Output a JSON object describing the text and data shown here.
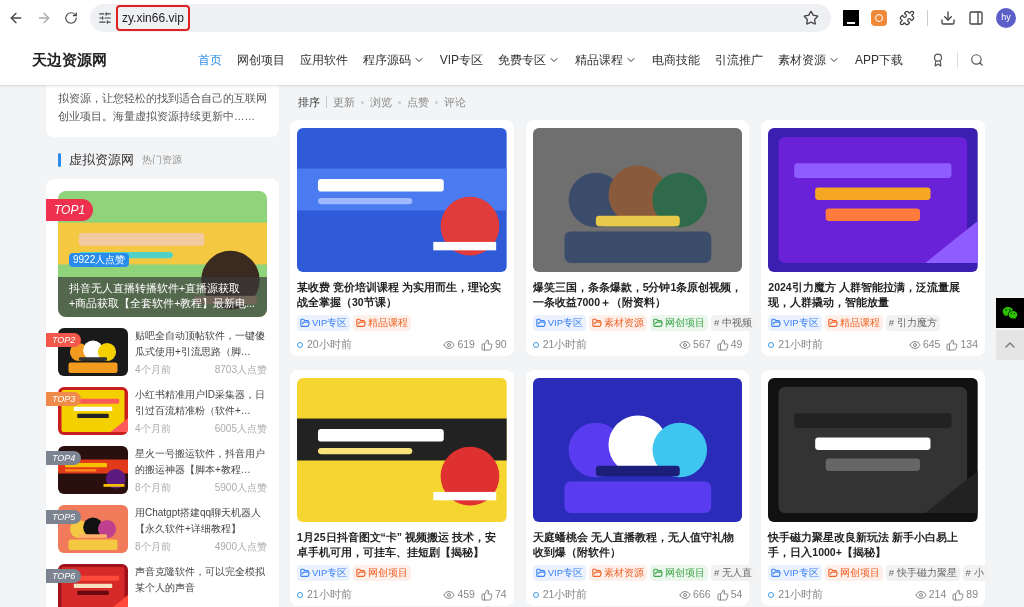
{
  "browser": {
    "url": "zy.xin66.vip",
    "profile": "hy"
  },
  "header": {
    "logo": "天边资源网",
    "nav": [
      {
        "label": "首页",
        "selected": true,
        "dropdown": false
      },
      {
        "label": "网创项目",
        "selected": false,
        "dropdown": false
      },
      {
        "label": "应用软件",
        "selected": false,
        "dropdown": false
      },
      {
        "label": "程序源码",
        "selected": false,
        "dropdown": true
      },
      {
        "label": "VIP专区",
        "selected": false,
        "dropdown": false
      },
      {
        "label": "免费专区",
        "selected": false,
        "dropdown": true
      },
      {
        "label": "精品课程",
        "selected": false,
        "dropdown": true
      },
      {
        "label": "电商技能",
        "selected": false,
        "dropdown": false
      },
      {
        "label": "引流推广",
        "selected": false,
        "dropdown": false
      },
      {
        "label": "素材资源",
        "selected": false,
        "dropdown": true
      },
      {
        "label": "APP下载",
        "selected": false,
        "dropdown": false
      }
    ]
  },
  "sidebar": {
    "intro": "拟资源，让您轻松的找到适合自己的互联网创业项目。海量虚拟资源持续更新中……",
    "section_title": "虚拟资源网",
    "section_subtitle": "热门资源",
    "featured": {
      "rank": "TOP1",
      "color": "#f0304f",
      "likes": "9922人点赞",
      "title": "抖音无人直播转播软件+直播源获取+商品获取【全套软件+教程】最新电..."
    },
    "items": [
      {
        "rank": "TOP2",
        "color": "#f2574a",
        "title": "贴吧全自动顶帖软件，一键傻瓜式使用+引流思路（脚…",
        "time": "4个月前",
        "likes": "8703人点赞"
      },
      {
        "rank": "TOP3",
        "color": "#f08a4b",
        "title": "小红书精准用户ID采集器，日引过百流精准粉（软件+…",
        "time": "4个月前",
        "likes": "6005人点赞"
      },
      {
        "rank": "TOP4",
        "color": "#7b8490",
        "title": "星火一号搬运软件，抖音用户的搬运神器【脚本+教程…",
        "time": "8个月前",
        "likes": "5900人点赞"
      },
      {
        "rank": "TOP5",
        "color": "#7b8490",
        "title": "用Chatgpt搭建qq聊天机器人【永久软件+详细教程】",
        "time": "8个月前",
        "likes": "4900人点赞"
      },
      {
        "rank": "TOP6",
        "color": "#7b8490",
        "title": "声音克隆软件，可以完全模拟某个人的声音"
      }
    ]
  },
  "sort": {
    "label": "排序",
    "options": [
      "更新",
      "浏览",
      "点赞",
      "评论"
    ]
  },
  "posts": [
    {
      "title": "某收费 竞价培训课程 为实用而生，理论实战全掌握（30节课）",
      "tags": [
        {
          "kind": "category",
          "label": "VIP专区",
          "color": "#3b82f6"
        },
        {
          "kind": "category",
          "label": "精品课程",
          "color": "#f0642a"
        }
      ],
      "time": "20小时前",
      "views": "619",
      "likes": "90"
    },
    {
      "title": "爆笑三国，条条爆款，5分钟1条原创视频，一条收益7000＋（附资料）",
      "tags": [
        {
          "kind": "category",
          "label": "VIP专区",
          "color": "#3b82f6"
        },
        {
          "kind": "category",
          "label": "素材资源",
          "color": "#f0642a"
        },
        {
          "kind": "category",
          "label": "网创项目",
          "color": "#3fa74a"
        },
        {
          "kind": "tag",
          "label": "# 中视频"
        }
      ],
      "time": "21小时前",
      "views": "567",
      "likes": "49"
    },
    {
      "title": "2024引力魔方 人群智能拉满，泛流量展现，人群撬动，智能放量",
      "tags": [
        {
          "kind": "category",
          "label": "VIP专区",
          "color": "#3b82f6"
        },
        {
          "kind": "category",
          "label": "精品课程",
          "color": "#f0642a"
        },
        {
          "kind": "tag",
          "label": "# 引力魔方"
        }
      ],
      "time": "21小时前",
      "views": "645",
      "likes": "134"
    },
    {
      "title": "1月25日抖音图文“卡” 视频搬运 技术，安卓手机可用，可挂车、挂短剧【揭秘】",
      "tags": [
        {
          "kind": "category",
          "label": "VIP专区",
          "color": "#3b82f6"
        },
        {
          "kind": "category",
          "label": "网创项目",
          "color": "#f0642a"
        }
      ],
      "time": "21小时前",
      "views": "459",
      "likes": "74"
    },
    {
      "title": "天庭蟠桃会 无人直播教程，无人值守礼物收到爆（附软件）",
      "tags": [
        {
          "kind": "category",
          "label": "VIP专区",
          "color": "#3b82f6"
        },
        {
          "kind": "category",
          "label": "素材资源",
          "color": "#f0642a"
        },
        {
          "kind": "category",
          "label": "网创项目",
          "color": "#3fa74a"
        },
        {
          "kind": "tag",
          "label": "# 无人直"
        }
      ],
      "time": "21小时前",
      "views": "666",
      "likes": "54"
    },
    {
      "title": "快手磁力聚星改良新玩法 新手小白易上手，日入1000+【揭秘】",
      "tags": [
        {
          "kind": "category",
          "label": "VIP专区",
          "color": "#3b82f6"
        },
        {
          "kind": "category",
          "label": "网创项目",
          "color": "#f0642a"
        },
        {
          "kind": "tag",
          "label": "# 快手磁力聚星"
        },
        {
          "kind": "tag",
          "label": "# 小"
        }
      ],
      "time": "21小时前",
      "views": "214",
      "likes": "89"
    }
  ]
}
